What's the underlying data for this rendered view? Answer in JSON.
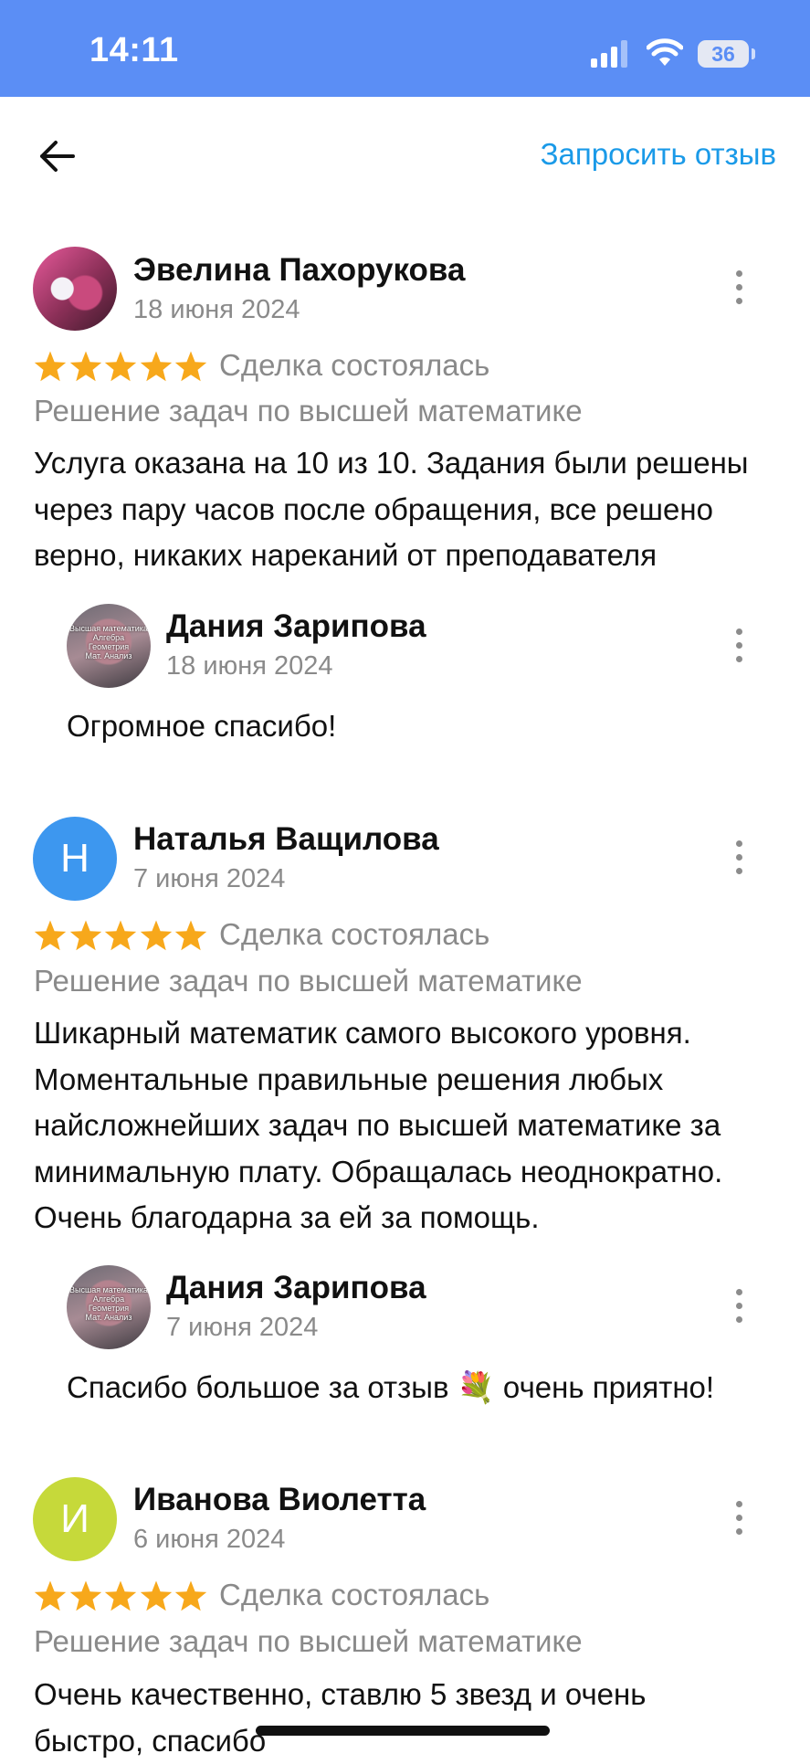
{
  "status_bar": {
    "time": "14:11",
    "battery": "36"
  },
  "nav": {
    "back_icon": "arrow-left-icon",
    "request_review": "Запросить отзыв"
  },
  "colors": {
    "accent": "#1a9ae8",
    "status_bar": "#5b8ef5",
    "star": "#f7a81b",
    "avatar_h": "#3d97ef",
    "avatar_i": "#c6d93a"
  },
  "reviews": [
    {
      "author": "Эвелина Пахорукова",
      "date": "18 июня 2024",
      "rating": 5,
      "deal_status": "Сделка состоялась",
      "service": "Решение задач по высшей математике",
      "text_lines": [
        "Услуга оказана на 10 из 10. Задания были решены",
        "через пару часов после обращения, все решено",
        "верно, никаких нареканий от преподавателя"
      ],
      "reply": {
        "author": "Дания Зарипова",
        "avatar_lines": [
          "Высшая математика",
          "Алгебра",
          "Геометрия",
          "Мат. Анализ"
        ],
        "date": "18 июня 2024",
        "text": "Огромное спасибо!"
      }
    },
    {
      "author": "Наталья Ващилова",
      "avatar_letter": "Н",
      "date": "7 июня 2024",
      "rating": 5,
      "deal_status": "Сделка состоялась",
      "service": "Решение задач по высшей математике",
      "text_lines": [
        "Шикарный математик самого высокого уровня.",
        "Моментальные правильные решения любых",
        "найсложнейших задач по высшей математике за",
        "минимальную плату. Обращалась неоднократно.",
        "Очень благодарна за ей за помощь."
      ],
      "reply": {
        "author": "Дания Зарипова",
        "avatar_lines": [
          "Высшая математика",
          "Алгебра",
          "Геометрия",
          "Мат. Анализ"
        ],
        "date": "7 июня 2024",
        "text": "Спасибо большое за отзыв 💐 очень приятно!"
      }
    },
    {
      "author": "Иванова Виолетта",
      "avatar_letter": "И",
      "date": "6 июня 2024",
      "rating": 5,
      "deal_status": "Сделка состоялась",
      "service": "Решение задач по высшей математике",
      "text_lines": [
        "Очень качественно, ставлю 5 звезд и очень",
        "быстро, спасибо"
      ]
    }
  ]
}
